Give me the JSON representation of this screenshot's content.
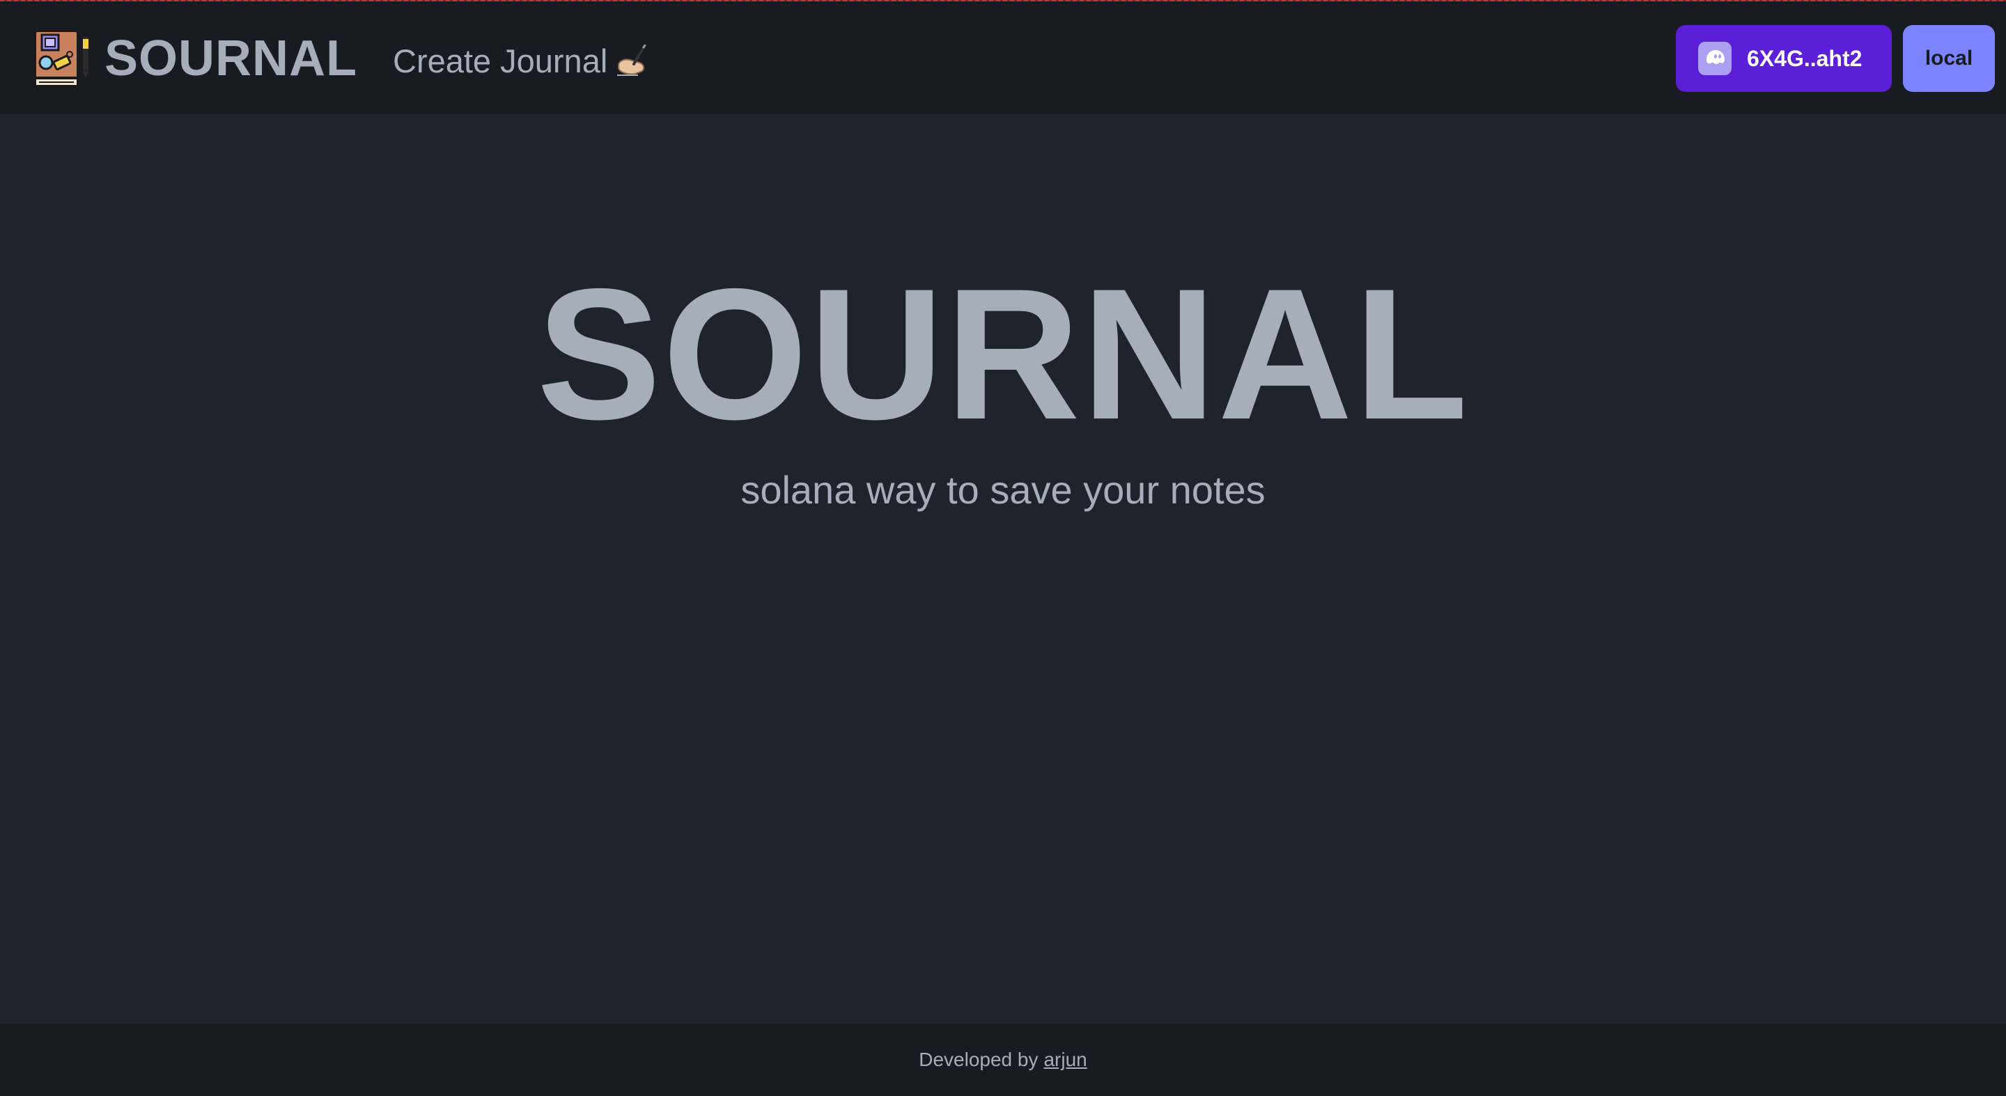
{
  "navbar": {
    "brand": "SOURNAL",
    "links": [
      {
        "label": "Create Journal",
        "emoji": "✍🏻"
      }
    ],
    "wallet_button": {
      "label": "6X4G..aht2"
    },
    "cluster_button": {
      "label": "local"
    }
  },
  "hero": {
    "title": "SOURNAL",
    "subtitle": "solana way to save your notes"
  },
  "footer": {
    "prefix": "Developed by",
    "author_link": "arjun"
  },
  "colors": {
    "background": "#1f232c",
    "navbar": "#181b21",
    "text": "#a6adbb",
    "wallet_button": "#5b1fd8",
    "cluster_button": "#7b83ff"
  },
  "icons": {
    "brand_logo": "journal-book-icon",
    "wallet": "phantom-ghost-icon"
  }
}
